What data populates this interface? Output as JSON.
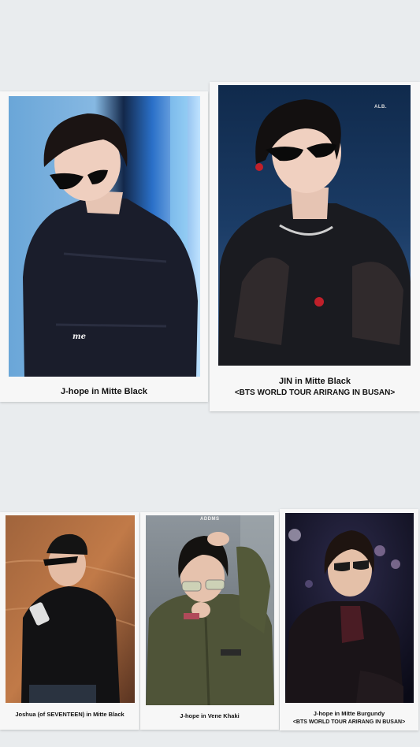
{
  "top_row": [
    {
      "caption": "J-hope in Mitte Black",
      "photo_icon": "person-black-jacket-photo",
      "watermark": "me"
    },
    {
      "caption_line1": "JIN in Mitte Black",
      "caption_line2": "<BTS WORLD TOUR ARIRANG IN BUSAN>",
      "photo_icon": "person-sheer-black-jacket-photo",
      "watermark": "ALB."
    }
  ],
  "bottom_row": [
    {
      "caption": "Joshua (of SEVENTEEN) in Mitte Black",
      "photo_icon": "person-black-knit-photo"
    },
    {
      "caption": "J-hope in Vene Khaki",
      "photo_icon": "person-khaki-jacket-photo",
      "watermark": "ADDMS"
    },
    {
      "caption_line1": "J-hope in Mitte Burgundy",
      "caption_line2": "<BTS WORLD TOUR ARIRANG IN BUSAN>",
      "photo_icon": "person-burgundy-jacket-photo"
    }
  ],
  "colors": {
    "background": "#e9ecee",
    "card": "#f7f7f7",
    "caption_text": "#111111"
  }
}
